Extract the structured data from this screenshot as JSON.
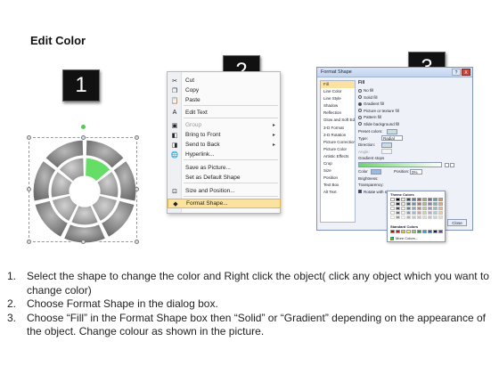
{
  "title": "Edit Color",
  "badges": [
    "1",
    "2",
    "3"
  ],
  "context_menu": {
    "items": [
      {
        "label": "Cut",
        "icon": "scissors-icon",
        "glyph": "✂",
        "disabled": false,
        "submenu": false
      },
      {
        "label": "Copy",
        "icon": "copy-icon",
        "glyph": "❐",
        "disabled": false,
        "submenu": false
      },
      {
        "label": "Paste",
        "icon": "paste-icon",
        "glyph": "📋",
        "disabled": false,
        "submenu": false
      },
      {
        "label": "Edit Text",
        "icon": "edit-text-icon",
        "glyph": "A",
        "disabled": false,
        "submenu": false
      },
      {
        "label": "Group",
        "icon": "group-icon",
        "glyph": "▣",
        "disabled": true,
        "submenu": true
      },
      {
        "label": "Bring to Front",
        "icon": "bring-front-icon",
        "glyph": "◧",
        "disabled": false,
        "submenu": true
      },
      {
        "label": "Send to Back",
        "icon": "send-back-icon",
        "glyph": "◨",
        "disabled": false,
        "submenu": true
      },
      {
        "label": "Hyperlink...",
        "icon": "hyperlink-icon",
        "glyph": "🌐",
        "disabled": false,
        "submenu": false
      },
      {
        "label": "Save as Picture...",
        "icon": "",
        "glyph": "",
        "disabled": false,
        "submenu": false
      },
      {
        "label": "Set as Default Shape",
        "icon": "",
        "glyph": "",
        "disabled": false,
        "submenu": false
      },
      {
        "label": "Size and Position...",
        "icon": "size-icon",
        "glyph": "⊡",
        "disabled": false,
        "submenu": false
      },
      {
        "label": "Format Shape...",
        "icon": "format-shape-icon",
        "glyph": "◆",
        "disabled": false,
        "submenu": false,
        "highlighted": true
      }
    ]
  },
  "dialog": {
    "title": "Format Shape",
    "help": "?",
    "close": "X",
    "nav": [
      "Fill",
      "Line Color",
      "Line Style",
      "Shadow",
      "Reflection",
      "Glow and Soft Edges",
      "3-D Format",
      "3-D Rotation",
      "Picture Corrections",
      "Picture Color",
      "Artistic Effects",
      "Crop",
      "Size",
      "Position",
      "Text Box",
      "Alt Text"
    ],
    "fill_heading": "Fill",
    "options": [
      "No fill",
      "Solid fill",
      "Gradient fill",
      "Picture or texture fill",
      "Pattern fill",
      "Slide background fill"
    ],
    "preset_colors": "Preset colors:",
    "type_label": "Type:",
    "type_value": "Radial",
    "direction_label": "Direction:",
    "angle_label": "Angle:",
    "gradient_stops": "Gradient stops",
    "color_label": "Color",
    "position_label": "Position:",
    "position_value": "0%",
    "brightness_label": "Brightness:",
    "transparency_label": "Transparency:",
    "rotate_label": "Rotate with shape",
    "theme_colors": "Theme Colors",
    "standard_colors": "Standard Colors",
    "more_colors": "More Colors...",
    "close_button": "Close"
  },
  "steps": [
    {
      "num": "1.",
      "text": "Select the shape to change the color and Right click the object( click any object which you want to change color)"
    },
    {
      "num": "2.",
      "text": "Choose Format Shape in the dialog box."
    },
    {
      "num": "3.",
      "text": "Choose “Fill” in the Format Shape box then “Solid” or “Gradient” depending on the appearance of the object. Change colour as shown in the picture."
    }
  ],
  "colors": {
    "accent_green": "#66dd66",
    "segment_gray": "#8a8a8a",
    "menu_highlight": "#fbe2a0"
  }
}
